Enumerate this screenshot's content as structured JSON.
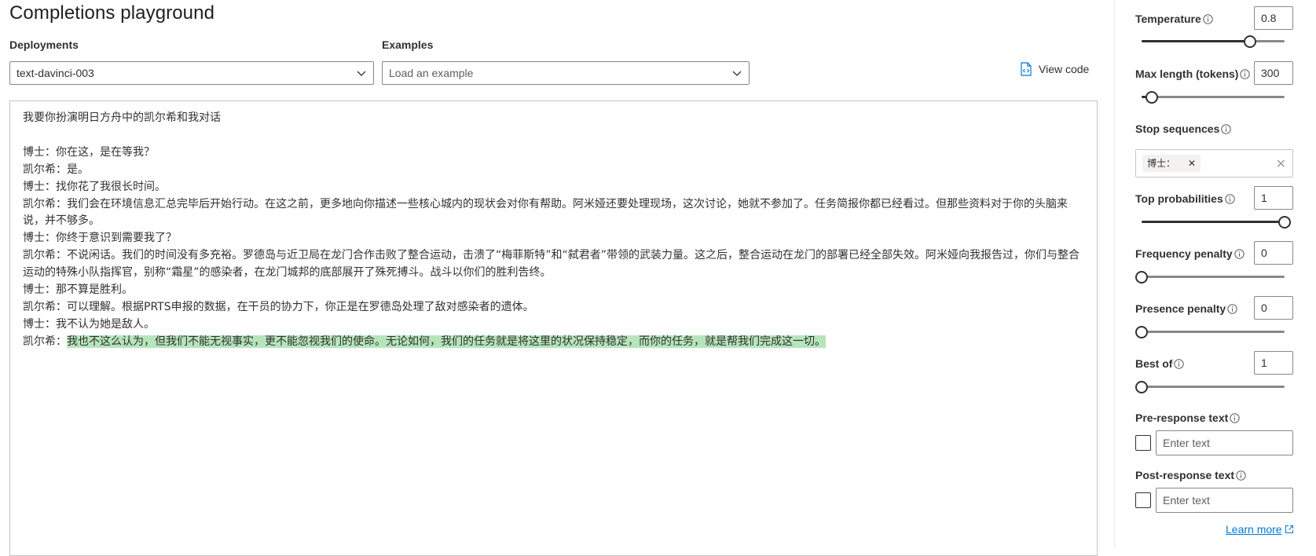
{
  "header": {
    "title": "Completions playground"
  },
  "deployments": {
    "label": "Deployments",
    "value": "text-davinci-003"
  },
  "examples": {
    "label": "Examples",
    "placeholder": "Load an example"
  },
  "view_code": {
    "label": "View code"
  },
  "editor": {
    "lines": [
      "我要你扮演明日方舟中的凯尔希和我对话",
      "",
      "博士：你在这，是在等我？",
      "凯尔希：是。",
      "博士：找你花了我很长时间。",
      "凯尔希：我们会在环境信息汇总完毕后开始行动。在这之前，更多地向你描述一些核心城内的现状会对你有帮助。阿米娅还要处理现场，这次讨论，她就不参加了。任务简报你都已经看过。但那些资料对于你的头脑来说，并不够多。",
      "博士：你终于意识到需要我了？",
      "凯尔希：不说闲话。我们的时间没有多充裕。罗德岛与近卫局在龙门合作击败了整合运动，击溃了“梅菲斯特”和“弑君者”带领的武装力量。这之后，整合运动在龙门的部署已经全部失效。阿米娅向我报告过，你们与整合运动的特殊小队指挥官，别称“霜星”的感染者，在龙门城邦的底部展开了殊死搏斗。战斗以你们的胜利告终。",
      "博士：那不算是胜利。",
      "凯尔希：可以理解。根据PRTS申报的数据，在干员的协力下，你正是在罗德岛处理了敌对感染者的遗体。",
      "博士：我不认为她是敌人。"
    ],
    "last_prefix": "凯尔希：",
    "last_completion": "我也不这么认为，但我们不能无视事实，更不能忽视我们的使命。无论如何，我们的任务就是将这里的状况保持稳定，而你的任务，就是帮我们完成这一切。"
  },
  "params": {
    "temperature": {
      "label": "Temperature",
      "value": "0.8",
      "fraction": 0.76
    },
    "max_length": {
      "label": "Max length (tokens)",
      "value": "300",
      "fraction": 0.07
    },
    "stop_sequences": {
      "label": "Stop sequences",
      "chip": "博士："
    },
    "top_p": {
      "label": "Top probabilities",
      "value": "1",
      "fraction": 1.0
    },
    "frequency_penalty": {
      "label": "Frequency penalty",
      "value": "0",
      "fraction": 0.0
    },
    "presence_penalty": {
      "label": "Presence penalty",
      "value": "0",
      "fraction": 0.0
    },
    "best_of": {
      "label": "Best of",
      "value": "1",
      "fraction": 0.0
    },
    "pre_response": {
      "label": "Pre-response text",
      "placeholder": "Enter text"
    },
    "post_response": {
      "label": "Post-response text",
      "placeholder": "Enter text"
    }
  },
  "learn_more": {
    "label": "Learn more"
  },
  "icons": {
    "info": "info-icon",
    "chevron": "chevron-down-icon",
    "code": "code-file-icon",
    "external": "external-link-icon"
  },
  "colors": {
    "accent": "#0078d4",
    "highlight": "#b6e5bb",
    "slider": "#323130"
  }
}
